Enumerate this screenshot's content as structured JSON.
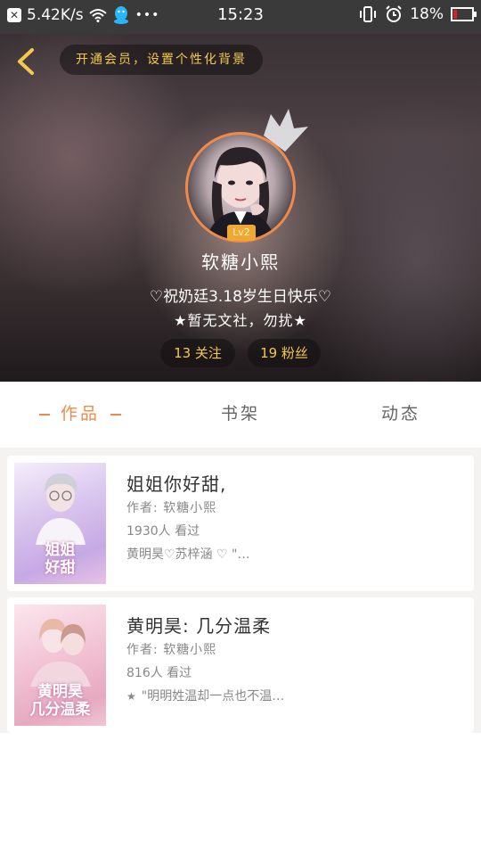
{
  "status_bar": {
    "speed": "5.42K/s",
    "time": "15:23",
    "battery": "18%",
    "battery_level": 0.18
  },
  "header": {
    "vip_prompt": "开通会员，设置个性化背景",
    "level": "Lv2",
    "username": "软糖小熙",
    "bio_line1": "♡祝奶廷3.18岁生日快乐♡",
    "bio_line2": "★暂无文社，勿扰★",
    "follow": "13 关注",
    "fans": "19 粉丝"
  },
  "tabs": [
    {
      "label": "作品",
      "active": true
    },
    {
      "label": "书架",
      "active": false
    },
    {
      "label": "动态",
      "active": false
    }
  ],
  "works": [
    {
      "title": "姐姐你好甜,",
      "author": "作者: 软糖小熙",
      "reads": "1930人 看过",
      "snippet": "黄明昊♡苏梓涵 ♡  \"…",
      "cover_title": "姐姐\n好甜"
    },
    {
      "title": "黄明昊: 几分温柔",
      "author": "作者: 软糖小熙",
      "reads": "816人 看过",
      "snippet": "\"明明姓温却一点也不温…",
      "cover_title": "黄明昊\n几分温柔"
    }
  ],
  "colors": {
    "accent": "#f08a4a",
    "gold": "#f5c84c"
  }
}
